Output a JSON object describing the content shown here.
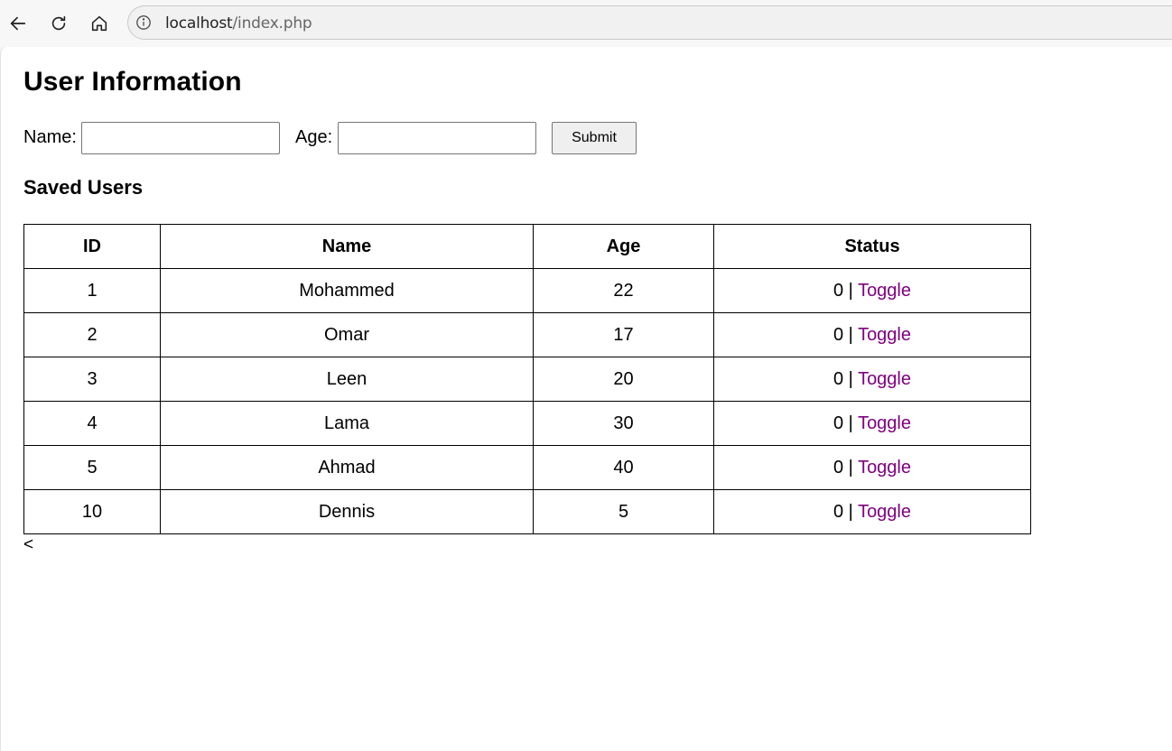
{
  "browser": {
    "url_host": "localhost",
    "url_path": "/index.php"
  },
  "page": {
    "title": "User Information",
    "form": {
      "name_label": "Name:",
      "name_value": "",
      "age_label": "Age:",
      "age_value": "",
      "submit_label": "Submit"
    },
    "subtitle": "Saved Users",
    "table": {
      "headers": [
        "ID",
        "Name",
        "Age",
        "Status"
      ],
      "rows": [
        {
          "id": "1",
          "name": "Mohammed",
          "age": "22",
          "status": "0",
          "sep": " | ",
          "action": "Toggle"
        },
        {
          "id": "2",
          "name": "Omar",
          "age": "17",
          "status": "0",
          "sep": " | ",
          "action": "Toggle"
        },
        {
          "id": "3",
          "name": "Leen",
          "age": "20",
          "status": "0",
          "sep": " | ",
          "action": "Toggle"
        },
        {
          "id": "4",
          "name": "Lama",
          "age": "30",
          "status": "0",
          "sep": " | ",
          "action": "Toggle"
        },
        {
          "id": "5",
          "name": "Ahmad",
          "age": "40",
          "status": "0",
          "sep": " | ",
          "action": "Toggle"
        },
        {
          "id": "10",
          "name": "Dennis",
          "age": "5",
          "status": "0",
          "sep": " | ",
          "action": "Toggle"
        }
      ]
    },
    "stray_text": "<"
  },
  "colors": {
    "link_visited": "#800080"
  }
}
